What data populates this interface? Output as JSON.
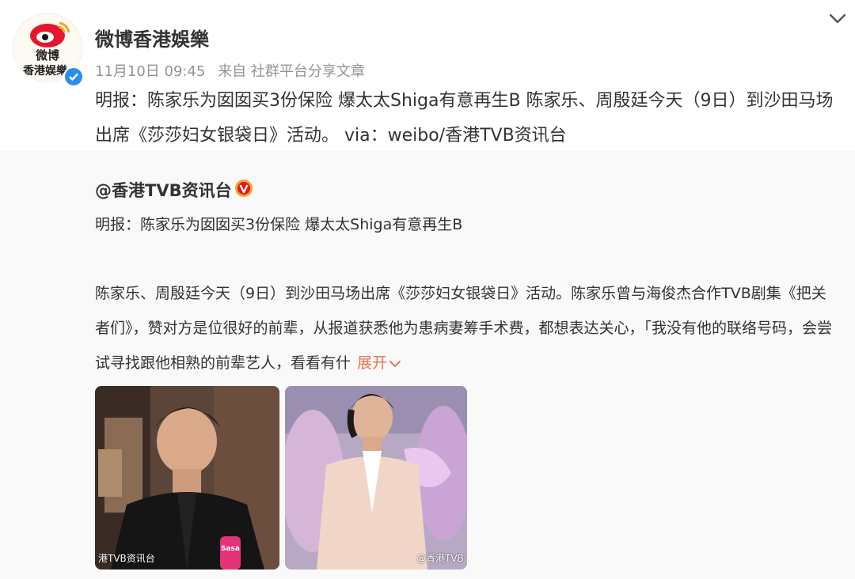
{
  "post": {
    "author": "微博香港娛樂",
    "date": "11月10日 09:45",
    "source": "来自 社群平台分享文章",
    "text": "明报：陈家乐为囡囡买3份保险 爆太太Shiga有意再生B 陈家乐、周殷廷今天（9日）到沙田马场出席《莎莎妇女银袋日》活动。 via：weibo/香港TVB资讯台",
    "avatar_text_top": "微博",
    "avatar_text_bottom": "香港娱樂"
  },
  "repost": {
    "author": "@香港TVB资讯台",
    "title": "明报：陈家乐为囡囡买3份保险 爆太太Shiga有意再生B",
    "body": "陈家乐、周殷廷今天（9日）到沙田马场出席《莎莎妇女银袋日》活动。陈家乐曾与海俊杰合作TVB剧集《把关者们》，赞对方是位很好的前辈，从报道获悉他为患病妻筹手术费，都想表达关心，「我没有他的联络号码，会尝试寻找跟他相熟的前辈艺人，看看有什",
    "expand_label": "展开",
    "photos": [
      {
        "watermark": "港TVB资讯台",
        "mic_label": "Sasa"
      },
      {
        "watermark": "@香港TVB"
      }
    ]
  },
  "colors": {
    "accent": "#eb7350",
    "verified": "#2d8cf0",
    "repost_bg": "#f9f9f9",
    "weibo_red": "#e6162d"
  },
  "icons": [
    "weibo-logo-icon",
    "verified-icon",
    "chevron-down-icon",
    "verified-gold-icon",
    "chevron-down-small-icon"
  ]
}
